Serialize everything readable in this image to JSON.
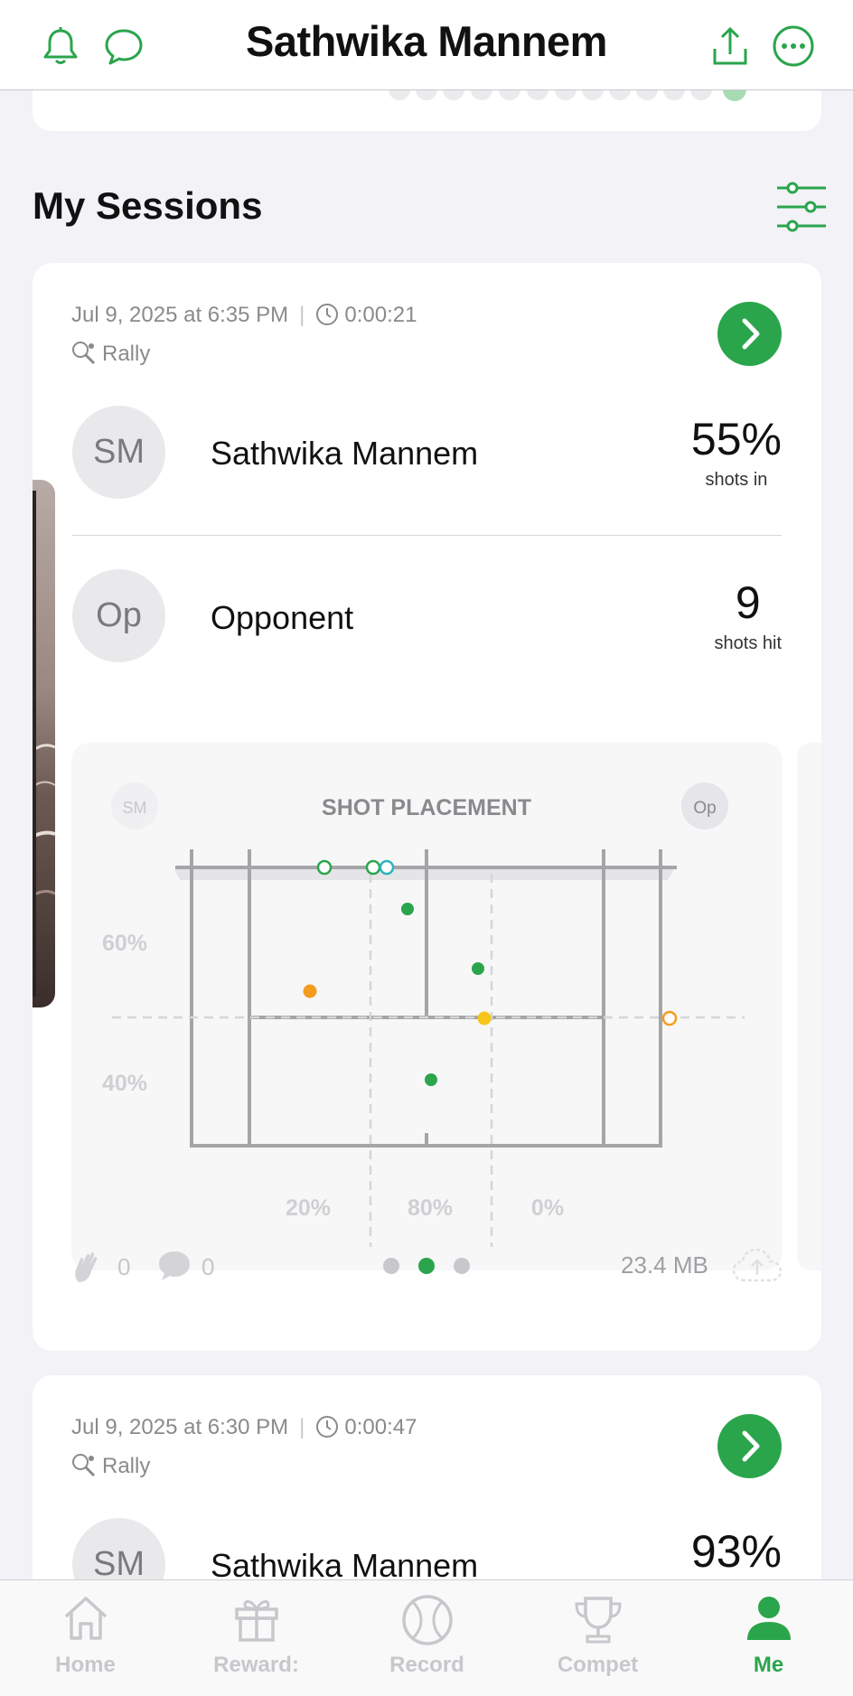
{
  "header": {
    "title": "Sathwika Mannem"
  },
  "section": {
    "title": "My Sessions"
  },
  "sessions": [
    {
      "date": "Jul 9, 2025 at 6:35 PM",
      "duration": "0:00:21",
      "type": "Rally",
      "player": {
        "initials": "SM",
        "name": "Sathwika Mannem",
        "stat": "55%",
        "stat_label": "shots in"
      },
      "opponent": {
        "initials": "Op",
        "name": "Opponent",
        "stat": "9",
        "stat_label": "shots hit"
      },
      "placement": {
        "title": "SHOT PLACEMENT",
        "left_badge": "SM",
        "right_badge": "Op",
        "row_pcts": [
          "60%",
          "40%"
        ],
        "col_pcts": [
          "20%",
          "80%",
          "0%"
        ]
      },
      "claps": "0",
      "comments": "0",
      "size": "23.4 MB",
      "pager": {
        "count": 3,
        "active": 1
      }
    },
    {
      "date": "Jul 9, 2025 at 6:30 PM",
      "duration": "0:00:47",
      "type": "Rally",
      "player": {
        "initials": "SM",
        "name": "Sathwika Mannem",
        "stat": "93%"
      }
    }
  ],
  "tabs": [
    {
      "label": "Home",
      "icon": "home-icon",
      "active": false
    },
    {
      "label": "Reward:",
      "icon": "gift-icon",
      "active": false
    },
    {
      "label": "Record",
      "icon": "ball-icon",
      "active": false
    },
    {
      "label": "Compet",
      "icon": "trophy-icon",
      "active": false
    },
    {
      "label": "Me",
      "icon": "person-icon",
      "active": true
    }
  ],
  "colors": {
    "accent": "#2aa54c",
    "orange": "#f39c1e",
    "yellow": "#f5c518",
    "teal": "#2bb3c0"
  }
}
